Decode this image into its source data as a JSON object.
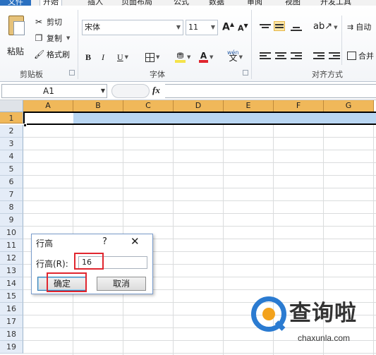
{
  "tabs": [
    "文件",
    "开始",
    "插入",
    "页面布局",
    "公式",
    "数据",
    "审阅",
    "视图",
    "开发工具"
  ],
  "clipboard": {
    "paste": "粘贴",
    "cut": "剪切",
    "copy": "复制",
    "format_painter": "格式刷",
    "group_label": "剪贴板"
  },
  "font": {
    "name": "宋体",
    "size": "11",
    "grow": "A",
    "shrink": "A",
    "bold": "B",
    "italic": "I",
    "underline": "U",
    "color_letter": "A",
    "wen": "wén",
    "group_label": "字体"
  },
  "alignment": {
    "wrap": "自动",
    "merge": "合并",
    "group_label": "对齐方式"
  },
  "formula_bar": {
    "name_box": "A1",
    "fx": "fx"
  },
  "grid": {
    "columns": [
      "A",
      "B",
      "C",
      "D",
      "E",
      "F",
      "G"
    ],
    "rows": [
      "1",
      "2",
      "3",
      "4",
      "5",
      "6",
      "7",
      "8",
      "9",
      "10",
      "11",
      "12",
      "13",
      "14",
      "15",
      "16",
      "17",
      "18",
      "19"
    ]
  },
  "dialog": {
    "title": "行高",
    "help": "?",
    "close": "✕",
    "label": "行高(R):",
    "value": "16",
    "ok": "确定",
    "cancel": "取消"
  },
  "watermark": {
    "cn": "查询啦",
    "en": "chaxunla.com"
  },
  "colors": {
    "selection": "#b9d6f2",
    "header_selected": "#f0b85a",
    "highlight_box": "#e0262f",
    "logo_blue": "#2b7bd1",
    "logo_orange": "#f3a21c"
  }
}
